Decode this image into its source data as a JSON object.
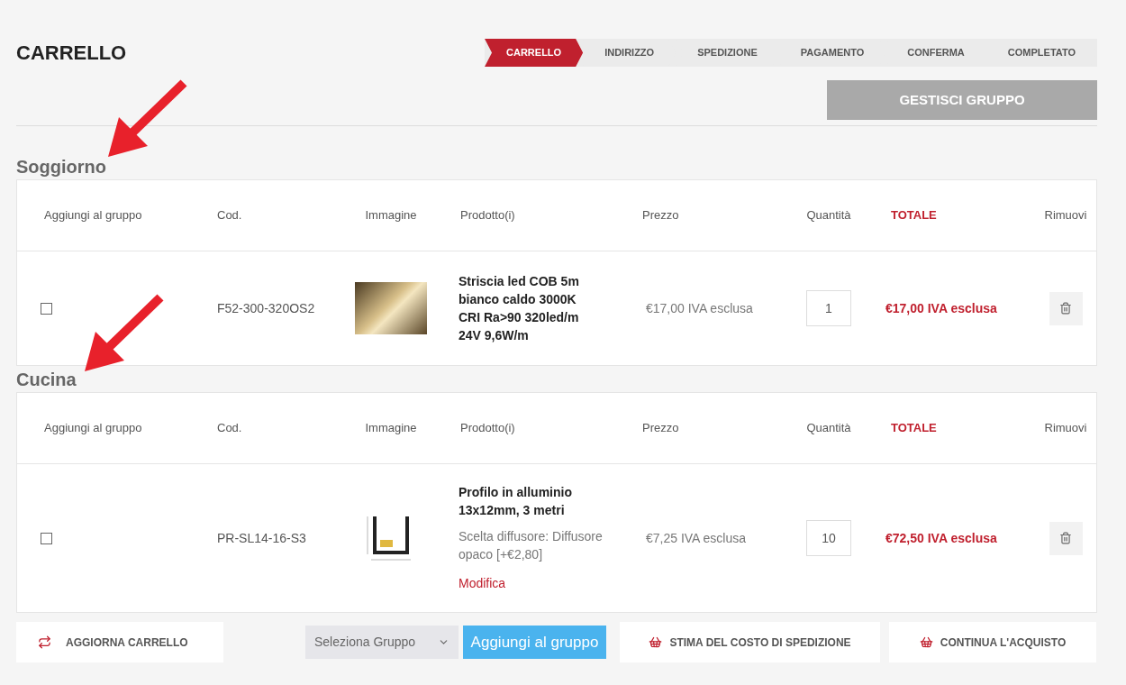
{
  "title": "CARRELLO",
  "steps": [
    {
      "label": "CARRELLO",
      "selected": true
    },
    {
      "label": "INDIRIZZO",
      "selected": false
    },
    {
      "label": "SPEDIZIONE",
      "selected": false
    },
    {
      "label": "PAGAMENTO",
      "selected": false
    },
    {
      "label": "CONFERMA",
      "selected": false
    },
    {
      "label": "COMPLETATO",
      "selected": false
    }
  ],
  "manage_button": "GESTISCI GRUPPO",
  "groups": [
    {
      "name": "Soggiorno",
      "columns": [
        "Aggiungi al gruppo",
        "Cod.",
        "Immagine",
        "Prodotto(i)",
        "Prezzo",
        "Quantità",
        "TOTALE",
        "Rimuovi"
      ],
      "rows": [
        {
          "checked": false,
          "code": "F52-300-320OS2",
          "image": {
            "kind": "photo"
          },
          "product": "Striscia led COB 5m bianco caldo 3000K CRI Ra>90 320led/m 24V 9,6W/m",
          "price": "€17,00 IVA esclusa",
          "quantity": "1",
          "total": "€17,00 IVA esclusa"
        }
      ]
    },
    {
      "name": "Cucina",
      "columns": [
        "Aggiungi al gruppo",
        "Cod.",
        "Immagine",
        "Prodotto(i)",
        "Prezzo",
        "Quantità",
        "TOTALE",
        "Rimuovi"
      ],
      "rows": [
        {
          "checked": false,
          "code": "PR-SL14-16-S3",
          "image": {
            "kind": "diagram"
          },
          "product": "Profilo in alluminio 13x12mm, 3 metri",
          "option": "Scelta diffusore: Diffusore opaco [+€2,80]",
          "edit_link": "Modifica",
          "price": "€7,25 IVA esclusa",
          "quantity": "10",
          "total": "€72,50 IVA esclusa"
        }
      ]
    }
  ],
  "footer": {
    "update_button": "AGGIORNA CARRELLO",
    "group_select": {
      "placeholder": "Seleziona Gruppo"
    },
    "add_to_group_button": "Aggiungi al gruppo",
    "shipping_button": "STIMA DEL COSTO DI SPEDIZIONE",
    "continue_button": "CONTINUA L'ACQUISTO"
  }
}
